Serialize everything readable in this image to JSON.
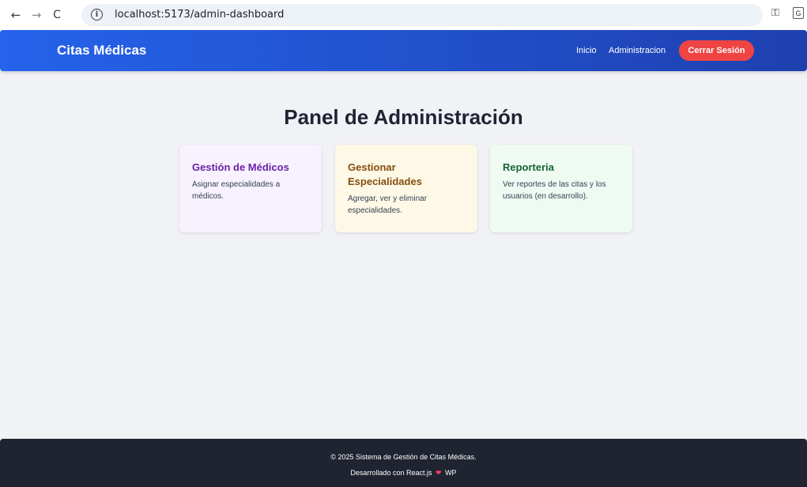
{
  "browser": {
    "url": "localhost:5173/admin-dashboard",
    "back_icon": "←",
    "forward_icon": "→",
    "reload_icon": "C",
    "info_icon": "i",
    "key_icon": "⚿",
    "translate_icon": "G"
  },
  "header": {
    "brand": "Citas Médicas",
    "nav": [
      {
        "label": "Inicio"
      },
      {
        "label": "Administracion"
      }
    ],
    "logout_label": "Cerrar Sesión"
  },
  "main": {
    "title": "Panel de Administración",
    "cards": [
      {
        "title": "Gestión de Médicos",
        "description": "Asignar especialidades a médicos."
      },
      {
        "title": "Gestionar Especialidades",
        "description": "Agregar, ver y eliminar especialidades."
      },
      {
        "title": "Reporteria",
        "description": "Ver reportes de las citas y los usuarios (en desarrollo)."
      }
    ]
  },
  "footer": {
    "line1": "© 2025 Sistema de Gestión de Citas Médicas.",
    "line2_prefix": "Desarrollado con React.js",
    "heart": "❤",
    "line2_suffix": "WP"
  },
  "colors": {
    "header_start": "#2563eb",
    "header_end": "#1e40af",
    "logout_button": "#ef4444",
    "footer_bg": "#1f2430",
    "card_medicos_bg": "#f7f2fe",
    "card_especialidades_bg": "#fef9e7",
    "card_reporteria_bg": "#effaf3"
  }
}
